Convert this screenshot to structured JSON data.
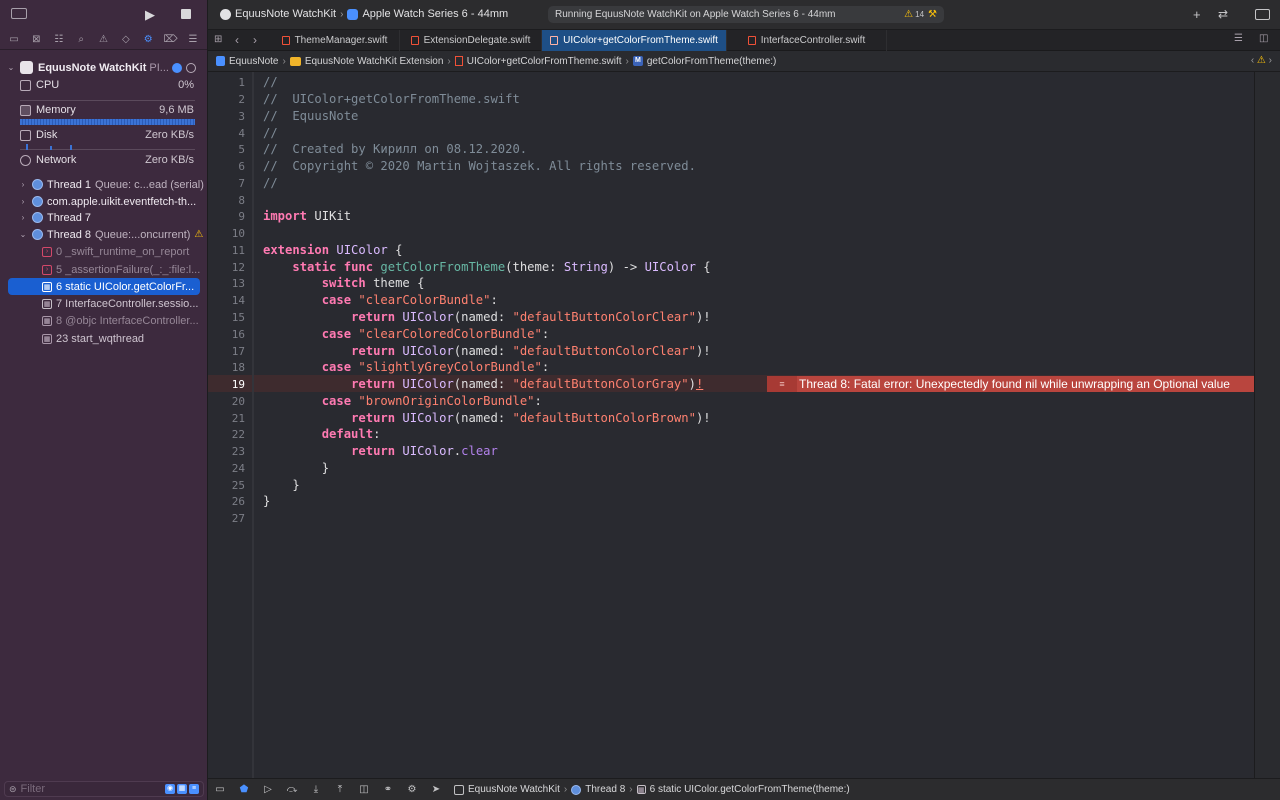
{
  "toolbar": {
    "scheme": "EquusNote WatchKit",
    "device": "Apple Watch Series 6 - 44mm",
    "activity": "Running EquusNote WatchKit on Apple Watch Series 6 - 44mm",
    "warning_count": "14"
  },
  "tabs": [
    {
      "label": "ThemeManager.swift"
    },
    {
      "label": "ExtensionDelegate.swift"
    },
    {
      "label": "UIColor+getColorFromTheme.swift"
    },
    {
      "label": "InterfaceController.swift"
    }
  ],
  "jumpbar": {
    "project": "EquusNote",
    "group": "EquusNote WatchKit Extension",
    "file": "UIColor+getColorFromTheme.swift",
    "symbol_badge": "M",
    "symbol": "getColorFromTheme(theme:)"
  },
  "navigator": {
    "process": "EquusNote WatchKit",
    "process_suffix": "PI...",
    "gauges": [
      {
        "label": "CPU",
        "value": "0%"
      },
      {
        "label": "Memory",
        "value": "9,6 MB"
      },
      {
        "label": "Disk",
        "value": "Zero KB/s"
      },
      {
        "label": "Network",
        "value": "Zero KB/s"
      }
    ],
    "threads": [
      {
        "name": "Thread 1",
        "detail": "Queue: c...ead (serial)"
      },
      {
        "name": "com.apple.uikit.eventfetch-th...",
        "detail": ""
      },
      {
        "name": "Thread 7",
        "detail": ""
      },
      {
        "name": "Thread 8",
        "detail": "Queue:...oncurrent)"
      }
    ],
    "frames": [
      {
        "label": "0 _swift_runtime_on_report"
      },
      {
        "label": "5 _assertionFailure(_:_:file:l..."
      },
      {
        "label": "6 static UIColor.getColorFr..."
      },
      {
        "label": "7 InterfaceController.sessio..."
      },
      {
        "label": "8 @objc InterfaceController..."
      },
      {
        "label": "23 start_wqthread"
      }
    ],
    "filter_placeholder": "Filter"
  },
  "editor": {
    "line_numbers": [
      "1",
      "2",
      "3",
      "4",
      "5",
      "6",
      "7",
      "8",
      "9",
      "10",
      "11",
      "12",
      "13",
      "14",
      "15",
      "16",
      "17",
      "18",
      "19",
      "20",
      "21",
      "22",
      "23",
      "24",
      "25",
      "26",
      "27"
    ],
    "current_line": "19",
    "lines": {
      "l1": "//",
      "l2": "//  UIColor+getColorFromTheme.swift",
      "l3": "//  EquusNote",
      "l4": "//",
      "l5": "//  Created by Кирилл on 08.12.2020.",
      "l6": "//  Copyright © 2020 Martin Wojtaszek. All rights reserved.",
      "l7": "//",
      "kw_import": "import",
      "mod_uikit": " UIKit",
      "kw_extension": "extension",
      "ty_uicolor": " UIColor",
      "brace_open": " {",
      "kw_static": "static",
      "kw_func": " func",
      "fn_name": " getColorFromTheme",
      "p_theme": "(theme: ",
      "ty_string": "String",
      "p_arrow": ") -> ",
      "ty_uicolor2": "UIColor",
      "kw_switch": "switch",
      "p_theme_var": " theme {",
      "kw_case": "case",
      "s_clear": " \"clearColorBundle\"",
      "s_cleared": " \"clearColoredColorBundle\"",
      "s_grey": " \"slightlyGreyColorBundle\"",
      "s_brown": " \"brownOriginColorBundle\"",
      "colon": ":",
      "kw_return": "return",
      "ty_uicolor3": " UIColor",
      "p_named": "(named: ",
      "s_clearval": "\"defaultButtonColorClear\"",
      "s_grayval": "\"defaultButtonColorGray\"",
      "s_brownval": "\"defaultButtonColorBrown\"",
      "p_close": ")",
      "bang": "!",
      "kw_default": "default",
      "dot": ".",
      "pr_clear": "clear",
      "close_brace": "}"
    },
    "error_message": "Thread 8: Fatal error: Unexpectedly found nil while unwrapping an Optional value"
  },
  "debugbar": {
    "app": "EquusNote WatchKit",
    "thread": "Thread 8",
    "frame": "6 static UIColor.getColorFromTheme(theme:)"
  },
  "colors": {
    "navigator_bg": "#3d2a3e",
    "selection": "#1a5fd1",
    "active_tab": "#1e4f86",
    "error_banner": "#b9453e",
    "warning": "#ffc40a"
  }
}
